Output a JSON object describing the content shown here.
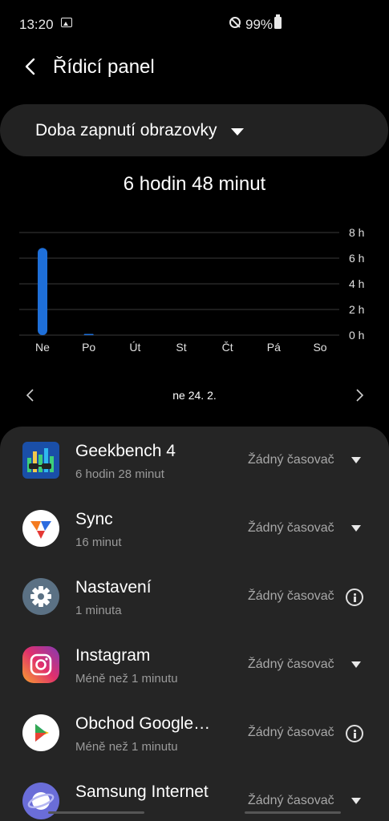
{
  "status_bar": {
    "time": "13:20",
    "battery": "99%"
  },
  "header": {
    "title": "Řídicí panel",
    "back_icon": "chevron-left-icon"
  },
  "selector": {
    "label": "Doba zapnutí obrazovky"
  },
  "summary": {
    "total": "6 hodin 48 minut"
  },
  "chart_data": {
    "type": "bar",
    "categories": [
      "Ne",
      "Po",
      "Út",
      "St",
      "Čt",
      "Pá",
      "So"
    ],
    "values": [
      6.8,
      0.05,
      0,
      0,
      0,
      0,
      0
    ],
    "unit": "h",
    "y_ticks": [
      "8 h",
      "6 h",
      "4 h",
      "2 h",
      "0 h"
    ],
    "ylim": [
      0,
      8
    ],
    "grid": true,
    "bar_color": "#1e6fd9"
  },
  "date_nav": {
    "label": "ne 24. 2."
  },
  "apps": [
    {
      "name": "Geekbench 4",
      "time": "6 hodin 28 minut",
      "timer": "Žádný časovač",
      "action": "dropdown",
      "icon": "geekbench-icon"
    },
    {
      "name": "Sync",
      "time": "16 minut",
      "timer": "Žádný časovač",
      "action": "dropdown",
      "icon": "sync-icon"
    },
    {
      "name": "Nastavení",
      "time": "1 minuta",
      "timer": "Žádný časovač",
      "action": "info",
      "icon": "settings-gear-icon"
    },
    {
      "name": "Instagram",
      "time": "Méně než 1 minutu",
      "timer": "Žádný časovač",
      "action": "dropdown",
      "icon": "instagram-icon"
    },
    {
      "name": "Obchod Google…",
      "time": "Méně než 1 minutu",
      "timer": "Žádný časovač",
      "action": "info",
      "icon": "play-store-icon"
    },
    {
      "name": "Samsung Internet",
      "time": "",
      "timer": "Žádný časovač",
      "action": "dropdown",
      "icon": "samsung-internet-icon"
    }
  ]
}
